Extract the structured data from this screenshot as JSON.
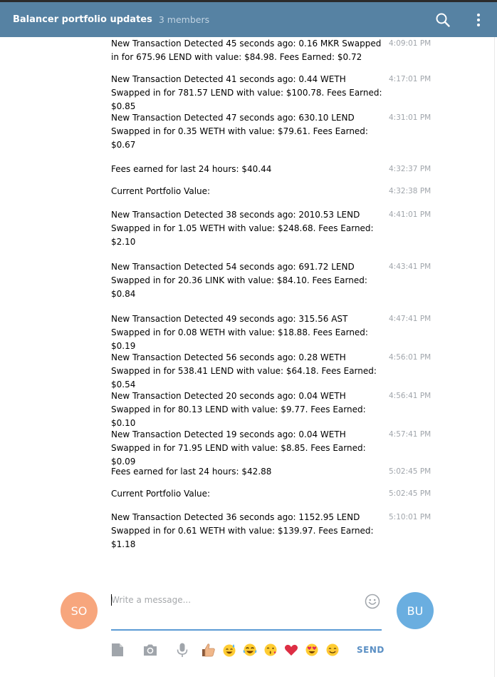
{
  "header": {
    "title": "Balancer portfolio updates",
    "members": "3 members"
  },
  "messages": [
    {
      "text": "New Transaction Detected 45 seconds ago: 0.16 MKR Swapped in for 675.96 LEND with value: $84.98. Fees Earned: $0.72",
      "time": "4:09:01 PM"
    },
    {
      "text": "New Transaction Detected 41 seconds ago: 0.44 WETH Swapped in for 781.57 LEND with value: $100.78. Fees Earned: $0.85",
      "time": "4:17:01 PM"
    },
    {
      "text": "New Transaction Detected 47 seconds ago: 630.10 LEND Swapped in for 0.35 WETH with value: $79.61. Fees Earned: $0.67",
      "time": "4:31:01 PM"
    },
    {
      "text": "Fees earned for last 24 hours: $40.44",
      "time": "4:32:37 PM"
    },
    {
      "text": "Current Portfolio Value:",
      "time": "4:32:38 PM"
    },
    {
      "text": "New Transaction Detected 38 seconds ago: 2010.53 LEND Swapped in for 1.05 WETH with value: $248.68. Fees Earned: $2.10",
      "time": "4:41:01 PM"
    },
    {
      "text": "New Transaction Detected 54 seconds ago: 691.72 LEND Swapped in for 20.36 LINK with value: $84.10. Fees Earned: $0.84",
      "time": "4:43:41 PM"
    },
    {
      "text": "New Transaction Detected 49 seconds ago: 315.56 AST Swapped in for 0.08 WETH with value: $18.88. Fees Earned: $0.19",
      "time": "4:47:41 PM"
    },
    {
      "text": "New Transaction Detected 56 seconds ago: 0.28 WETH Swapped in for 538.41 LEND with value: $64.18. Fees Earned: $0.54",
      "time": "4:56:01 PM"
    },
    {
      "text": "New Transaction Detected 20 seconds ago: 0.04 WETH Swapped in for 80.13 LEND with value: $9.77. Fees Earned: $0.10",
      "time": "4:56:41 PM"
    },
    {
      "text": "New Transaction Detected 19 seconds ago: 0.04 WETH Swapped in for 71.95 LEND with value: $8.85. Fees Earned: $0.09",
      "time": "4:57:41 PM"
    },
    {
      "text": "Fees earned for last 24 hours: $42.88",
      "time": "5:02:45 PM"
    },
    {
      "text": "Current Portfolio Value:",
      "time": "5:02:45 PM"
    },
    {
      "text": "New Transaction Detected 36 seconds ago: 1152.95 LEND Swapped in for 0.61 WETH with value: $139.97. Fees Earned: $1.18",
      "time": "5:10:01 PM"
    }
  ],
  "composer": {
    "my_avatar": "SO",
    "peer_avatar": "BU",
    "placeholder": "Write a message...",
    "send_label": "SEND"
  },
  "toolbar_icons": [
    "attach-file-icon",
    "camera-icon",
    "microphone-icon",
    "thumbs-up-emoji",
    "sweat-smile-emoji",
    "tears-of-joy-emoji",
    "kissing-face-emoji",
    "red-heart-emoji",
    "heart-eyes-emoji",
    "smiling-face-emoji"
  ],
  "colors": {
    "header_bg": "#5682a3",
    "accent": "#5b9bd5",
    "timestamp": "#a0a5ab",
    "my_avatar_bg": "#f7a67d",
    "peer_avatar_bg": "#6aaee0"
  }
}
